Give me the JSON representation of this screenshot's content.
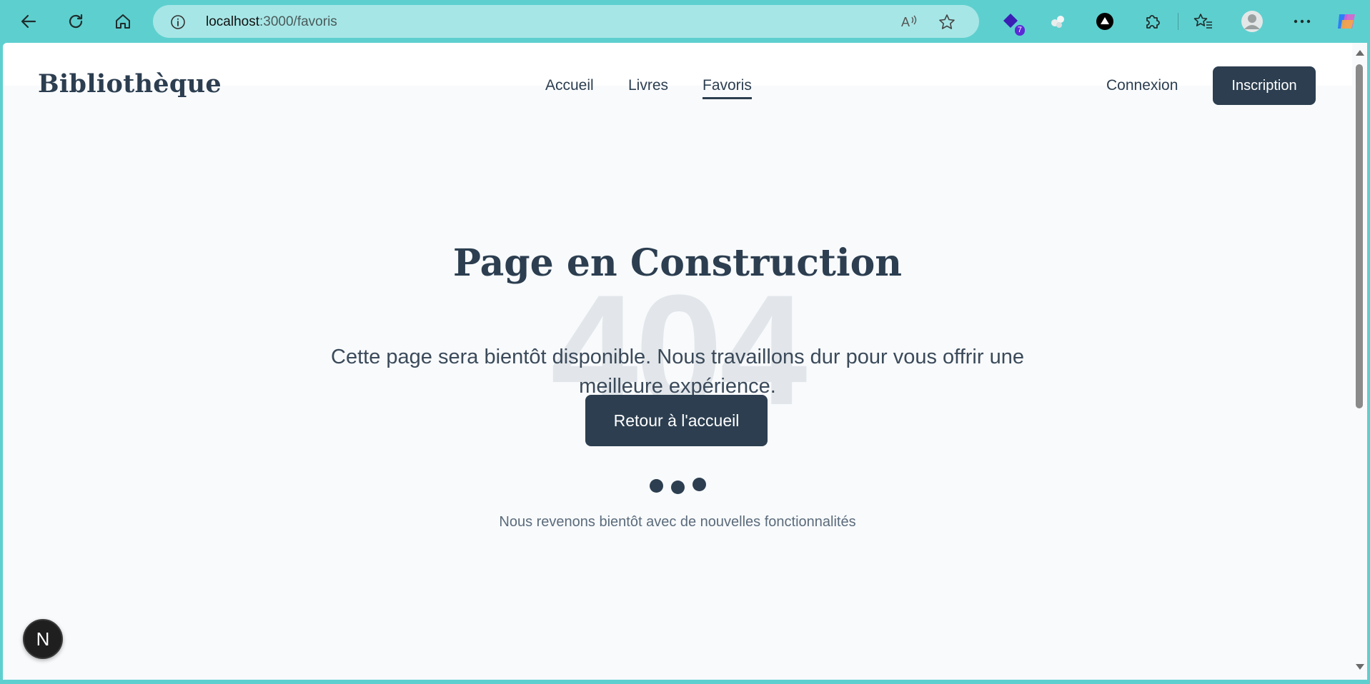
{
  "browser": {
    "url_host": "localhost",
    "url_path": ":3000/favoris",
    "extension_badge": "7",
    "icons": [
      "back-icon",
      "refresh-icon",
      "home-icon",
      "info-icon",
      "read-aloud-icon",
      "favorite-star-icon",
      "extension-icon",
      "puzzle-icon",
      "favorites-list-icon",
      "profile-icon",
      "more-icon",
      "copilot-icon"
    ]
  },
  "header": {
    "logo": "Bibliothèque",
    "nav": [
      {
        "label": "Accueil"
      },
      {
        "label": "Livres"
      },
      {
        "label": "Favoris",
        "active": true
      }
    ],
    "login_label": "Connexion",
    "register_label": "Inscription"
  },
  "main": {
    "background_code": "404",
    "title": "Page en Construction",
    "subtitle": "Cette page sera bientôt disponible. Nous travaillons dur pour vous offrir une meilleure expérience.",
    "home_button": "Retour à l'accueil",
    "footer_note": "Nous revenons bientôt avec de nouvelles fonctionnalités"
  },
  "dev_badge": "N",
  "colors": {
    "brand": "#2c3e50",
    "chrome": "#5ecfcf",
    "page_bg": "#f8fafc"
  }
}
